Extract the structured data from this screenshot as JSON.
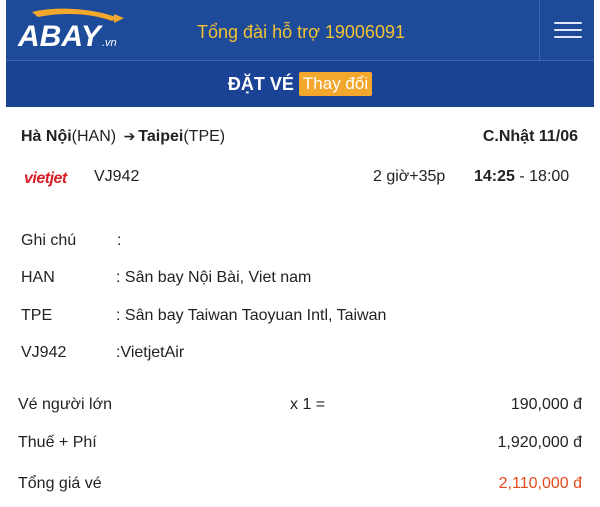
{
  "header": {
    "logo_text": "ABAY.vn",
    "hotline": "Tổng đài hỗ trợ 19006091",
    "menu_icon": "hamburger-icon"
  },
  "subheader": {
    "title": "ĐẶT VÉ",
    "change_label": "Thay đổi"
  },
  "flight": {
    "from_city": "Hà Nội",
    "from_code": "(HAN)",
    "to_city": "Taipei",
    "to_code": "(TPE)",
    "date": "C.Nhật 11/06",
    "airline_logo": "vietjet",
    "number": "VJ942",
    "duration": "2 giờ+35p",
    "depart": "14:25",
    "arrive": " - 18:00"
  },
  "details": [
    {
      "key": "Ghi chú",
      "value": ":"
    },
    {
      "key": "HAN",
      "value": ": Sân bay Nội Bài, Viet nam"
    },
    {
      "key": "TPE",
      "value": ": Sân bay Taiwan Taoyuan Intl, Taiwan"
    },
    {
      "key": "VJ942",
      "value": ":VietjetAir"
    }
  ],
  "prices": {
    "adult_label": "Vé người lớn",
    "adult_qty": "x 1 =",
    "adult_amount": "190,000 đ",
    "tax_label": "Thuế + Phí",
    "tax_amount": "1,920,000 đ",
    "total_label": "Tổng giá vé",
    "total_amount": "2,110,000 đ"
  },
  "colors": {
    "header_bg": "#1e4a9a",
    "hotline": "#f2c232",
    "accent_orange": "#f3a72c",
    "total_red": "#e34b1d",
    "vietjet_red": "#d91e25"
  }
}
